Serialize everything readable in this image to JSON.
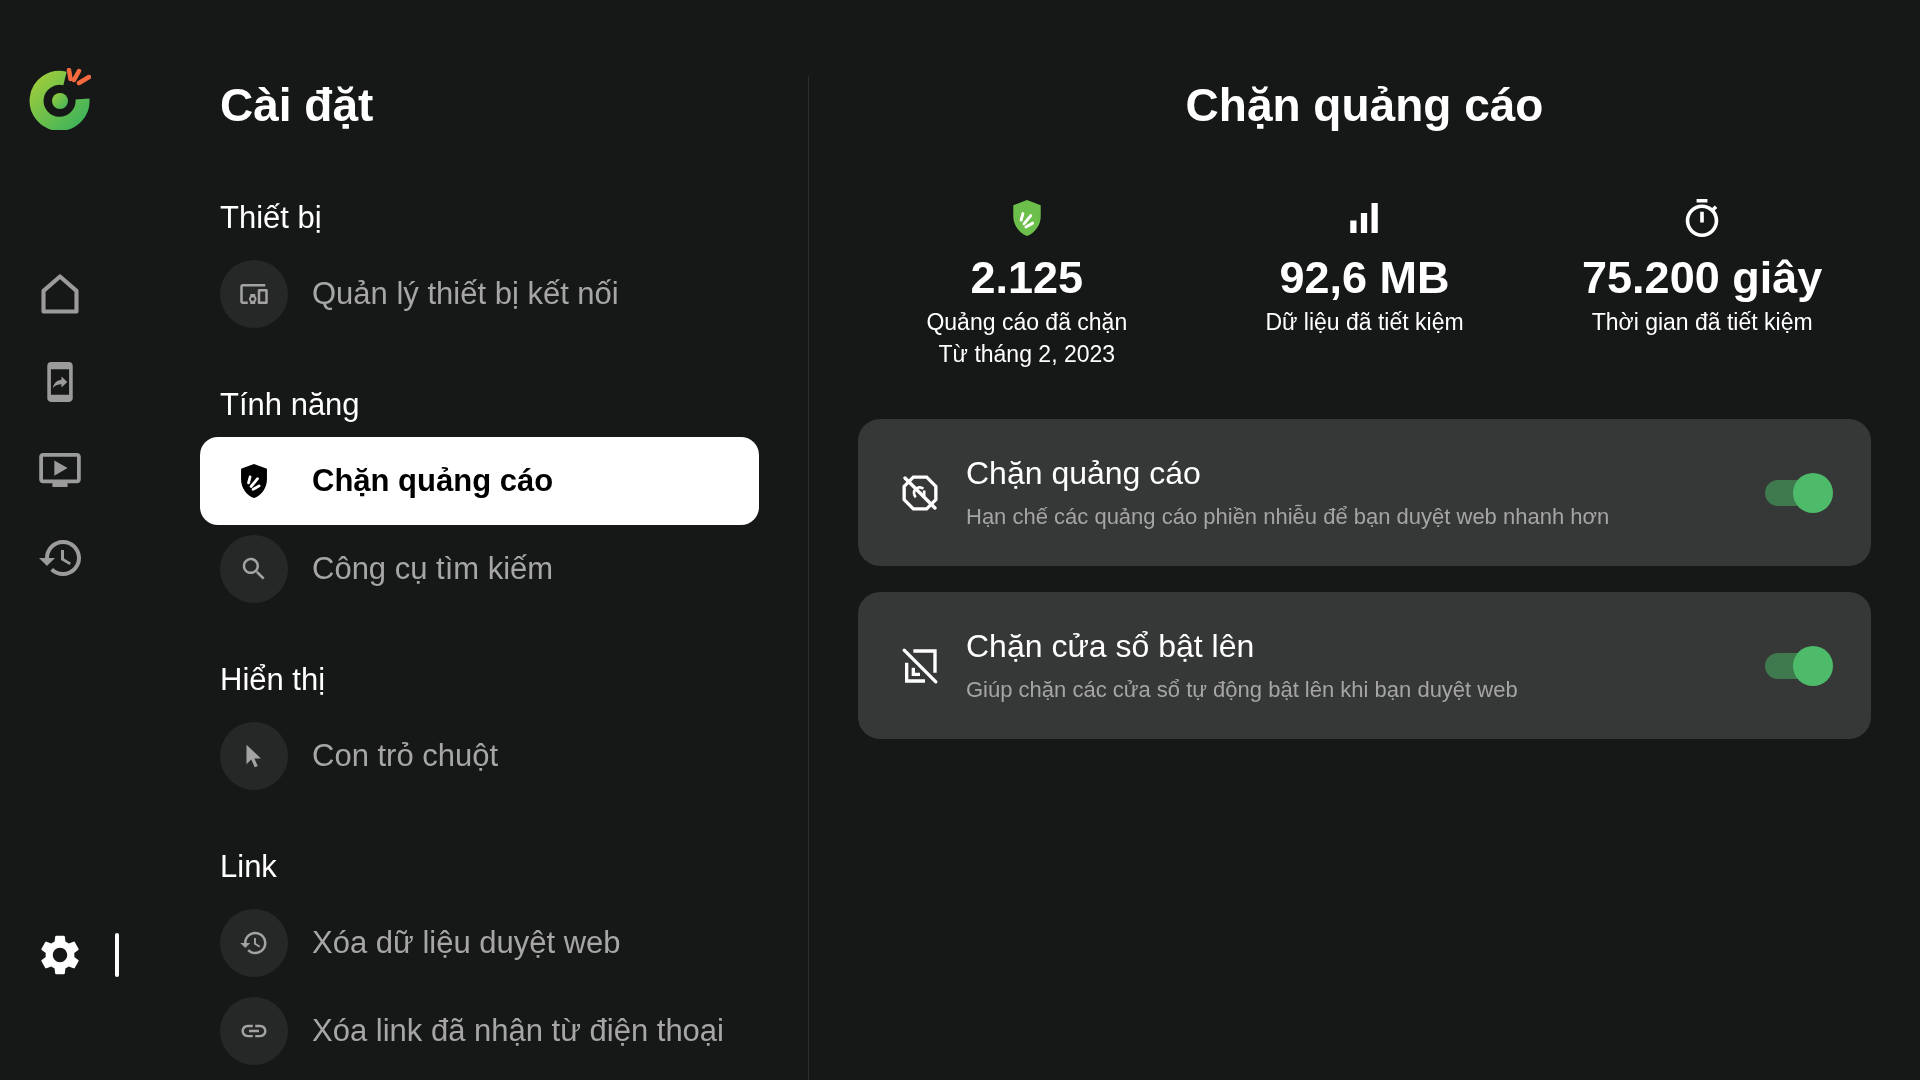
{
  "nav_rail": {
    "items": [
      {
        "selected": false
      },
      {
        "selected": false
      },
      {
        "selected": false
      },
      {
        "selected": false
      }
    ],
    "bottom_items": [
      {
        "selected": true
      }
    ]
  },
  "settings": {
    "title": "Cài đặt",
    "sections": [
      {
        "heading": "Thiết bị",
        "items": [
          {
            "label": "Quản lý thiết bị kết nối",
            "selected": false
          }
        ]
      },
      {
        "heading": "Tính năng",
        "items": [
          {
            "label": "Chặn quảng cáo",
            "selected": true
          },
          {
            "label": "Công cụ tìm kiếm",
            "selected": false
          }
        ]
      },
      {
        "heading": "Hiển thị",
        "items": [
          {
            "label": "Con trỏ chuột",
            "selected": false
          }
        ]
      },
      {
        "heading": "Link",
        "items": [
          {
            "label": "Xóa dữ liệu duyệt web",
            "selected": false
          },
          {
            "label": "Xóa link đã nhận từ điện thoại",
            "selected": false
          }
        ]
      }
    ]
  },
  "content": {
    "title": "Chặn quảng cáo",
    "stats": [
      {
        "value": "2.125",
        "label": "Quảng cáo đã chặn",
        "note": "Từ tháng 2, 2023"
      },
      {
        "value": "92,6 MB",
        "label": "Dữ liệu đã tiết kiệm"
      },
      {
        "value": "75.200 giây",
        "label": "Thời gian đã tiết kiệm"
      }
    ],
    "options": [
      {
        "title": "Chặn quảng cáo",
        "description": "Hạn chế các quảng cáo phiền nhiễu để bạn duyệt web nhanh hơn",
        "on": true
      },
      {
        "title": "Chặn cửa sổ bật lên",
        "description": "Giúp chặn các cửa sổ tự động bật lên khi bạn duyệt web",
        "on": true
      }
    ]
  }
}
